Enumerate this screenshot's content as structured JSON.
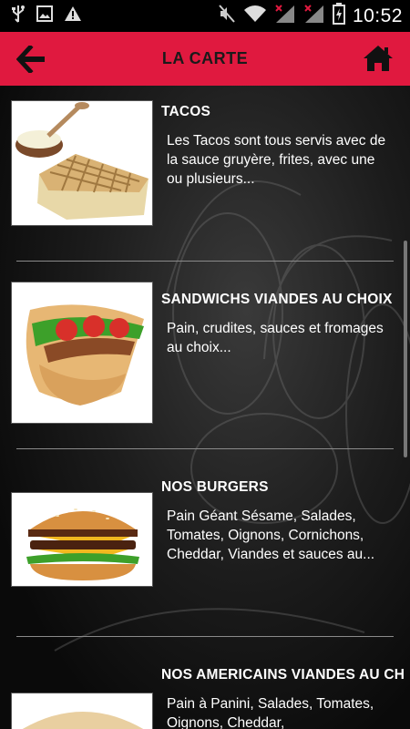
{
  "status_bar": {
    "time": "10:52",
    "icons": [
      "usb-icon",
      "image-icon",
      "warning-icon",
      "mute-icon",
      "wifi-icon",
      "signal-icon",
      "signal-icon",
      "battery-charging-icon"
    ]
  },
  "header": {
    "title": "LA CARTE",
    "background_color": "#e0193f",
    "back_icon": "arrow-left-icon",
    "home_icon": "home-icon"
  },
  "menu_items": [
    {
      "title": "TACOS",
      "description": "Les Tacos sont tous servis avec de la sauce gruyère, frites, avec une ou plusieurs..."
    },
    {
      "title": "SANDWICHS VIANDES AU CHOIX",
      "description": "Pain, crudites, sauces et fromages au choix..."
    },
    {
      "title": "NOS BURGERS",
      "description": "Pain Géant Sésame, Salades, Tomates, Oignons, Cornichons, Cheddar, Viandes et sauces au..."
    },
    {
      "title": "NOS AMERICAINS VIANDES AU CH",
      "description": "Pain à Panini, Salades, Tomates, Oignons, Cheddar,"
    }
  ]
}
